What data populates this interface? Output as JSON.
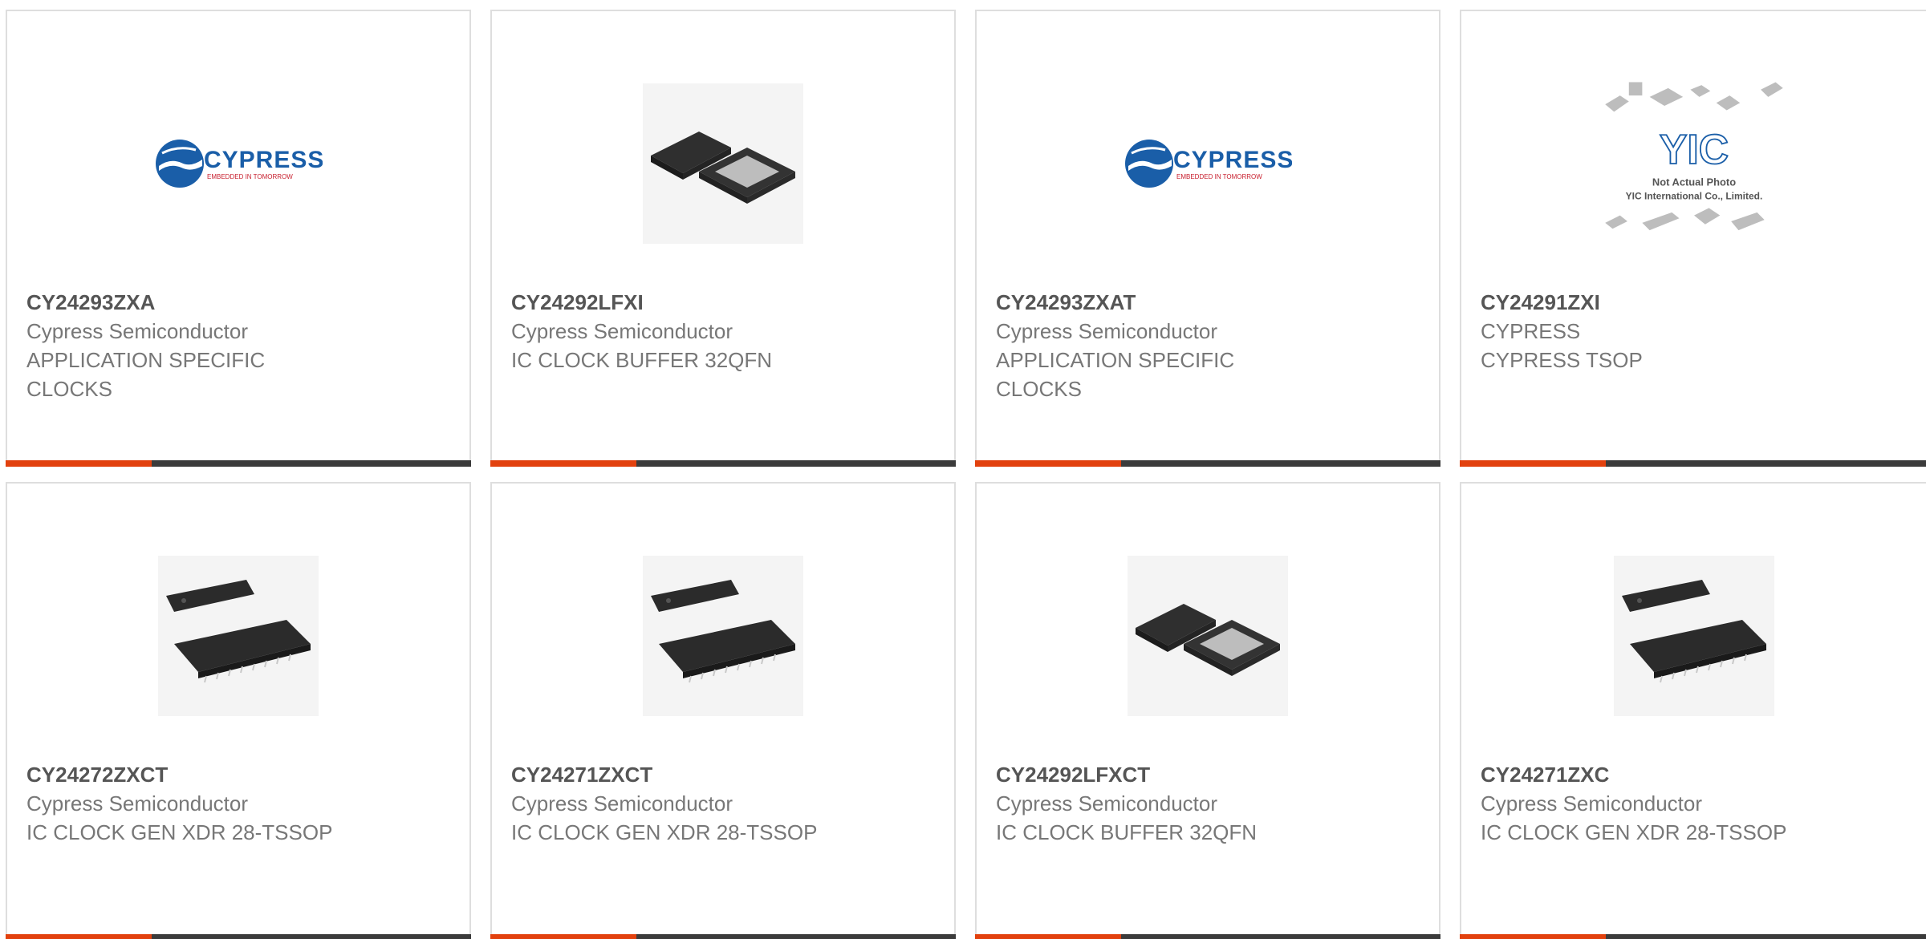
{
  "products": [
    {
      "part": "CY24293ZXA",
      "manufacturer": "Cypress Semiconductor",
      "description": "APPLICATION SPECIFIC CLOCKS",
      "image": "cypress-logo"
    },
    {
      "part": "CY24292LFXI",
      "manufacturer": "Cypress Semiconductor",
      "description": "IC CLOCK BUFFER 32QFN",
      "image": "qfn-chip"
    },
    {
      "part": "CY24293ZXAT",
      "manufacturer": "Cypress Semiconductor",
      "description": "APPLICATION SPECIFIC CLOCKS",
      "image": "cypress-logo"
    },
    {
      "part": "CY24291ZXI",
      "manufacturer": "CYPRESS",
      "description": "CYPRESS TSOP",
      "image": "yic-placeholder"
    },
    {
      "part": "CY24272ZXCT",
      "manufacturer": "Cypress Semiconductor",
      "description": "IC CLOCK GEN XDR 28-TSSOP",
      "image": "tssop-chip"
    },
    {
      "part": "CY24271ZXCT",
      "manufacturer": "Cypress Semiconductor",
      "description": "IC CLOCK GEN XDR 28-TSSOP",
      "image": "tssop-chip"
    },
    {
      "part": "CY24292LFXCT",
      "manufacturer": "Cypress Semiconductor",
      "description": "IC CLOCK BUFFER 32QFN",
      "image": "qfn-chip"
    },
    {
      "part": "CY24271ZXC",
      "manufacturer": "Cypress Semiconductor",
      "description": "IC CLOCK GEN XDR 28-TSSOP",
      "image": "tssop-chip"
    }
  ],
  "logo_text": {
    "cypress": "CYPRESS",
    "cypress_tagline": "EMBEDDED IN TOMORROW",
    "yic": "YIC",
    "yic_line1": "Not Actual Photo",
    "yic_line2": "YIC International Co., Limited."
  },
  "colors": {
    "accent": "#e2410e",
    "bar": "#3b3b3b",
    "cypress_blue": "#1a5ea8",
    "cypress_red": "#c8202f"
  }
}
